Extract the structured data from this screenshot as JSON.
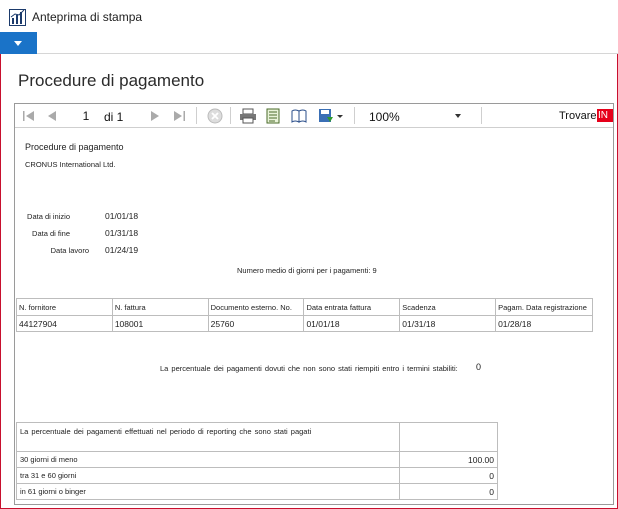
{
  "window": {
    "title": "Anteprima di stampa"
  },
  "page": {
    "title": "Procedure di pagamento"
  },
  "toolbar": {
    "page_current": "1",
    "page_of": "di 1",
    "zoom": "100%",
    "find_label": "Trovare",
    "find_extra": "IN"
  },
  "report": {
    "title": "Procedure di pagamento",
    "company": "CRONUS International Ltd.",
    "params": [
      {
        "label": "Data di inizio",
        "value": "01/01/18"
      },
      {
        "label": "Data di fine",
        "value": "01/31/18"
      },
      {
        "label": "Data lavoro",
        "value": "01/24/19"
      }
    ],
    "avg_days_text": "Numero medio di giorni per i pagamenti: 9",
    "payments": {
      "headers": [
        "N. fornitore",
        "N. fattura",
        "Documento esterno. No.",
        "Data entrata fattura",
        "Scadenza",
        "Pagam. Data registrazione"
      ],
      "rows": [
        [
          "44127904",
          "108001",
          "25760",
          "01/01/18",
          "01/31/18",
          "01/28/18"
        ]
      ]
    },
    "late_pct_text": "La percentuale dei pagamenti dovuti che non sono stati riempiti entro i termini stabiliti:",
    "late_pct_value": "0",
    "summary": {
      "header": "La percentuale dei pagamenti effettuati nel periodo di reporting che sono stati pagati",
      "rows": [
        {
          "label": "30 giorni di meno",
          "value": "100.00"
        },
        {
          "label": "tra 31 e 60 giorni",
          "value": "0"
        },
        {
          "label": "in 61 giorni o binger",
          "value": "0"
        }
      ]
    }
  },
  "colors": {
    "accent": "#1a73c8",
    "find_highlight": "#e6001a",
    "frame_border": "#c8102e"
  }
}
